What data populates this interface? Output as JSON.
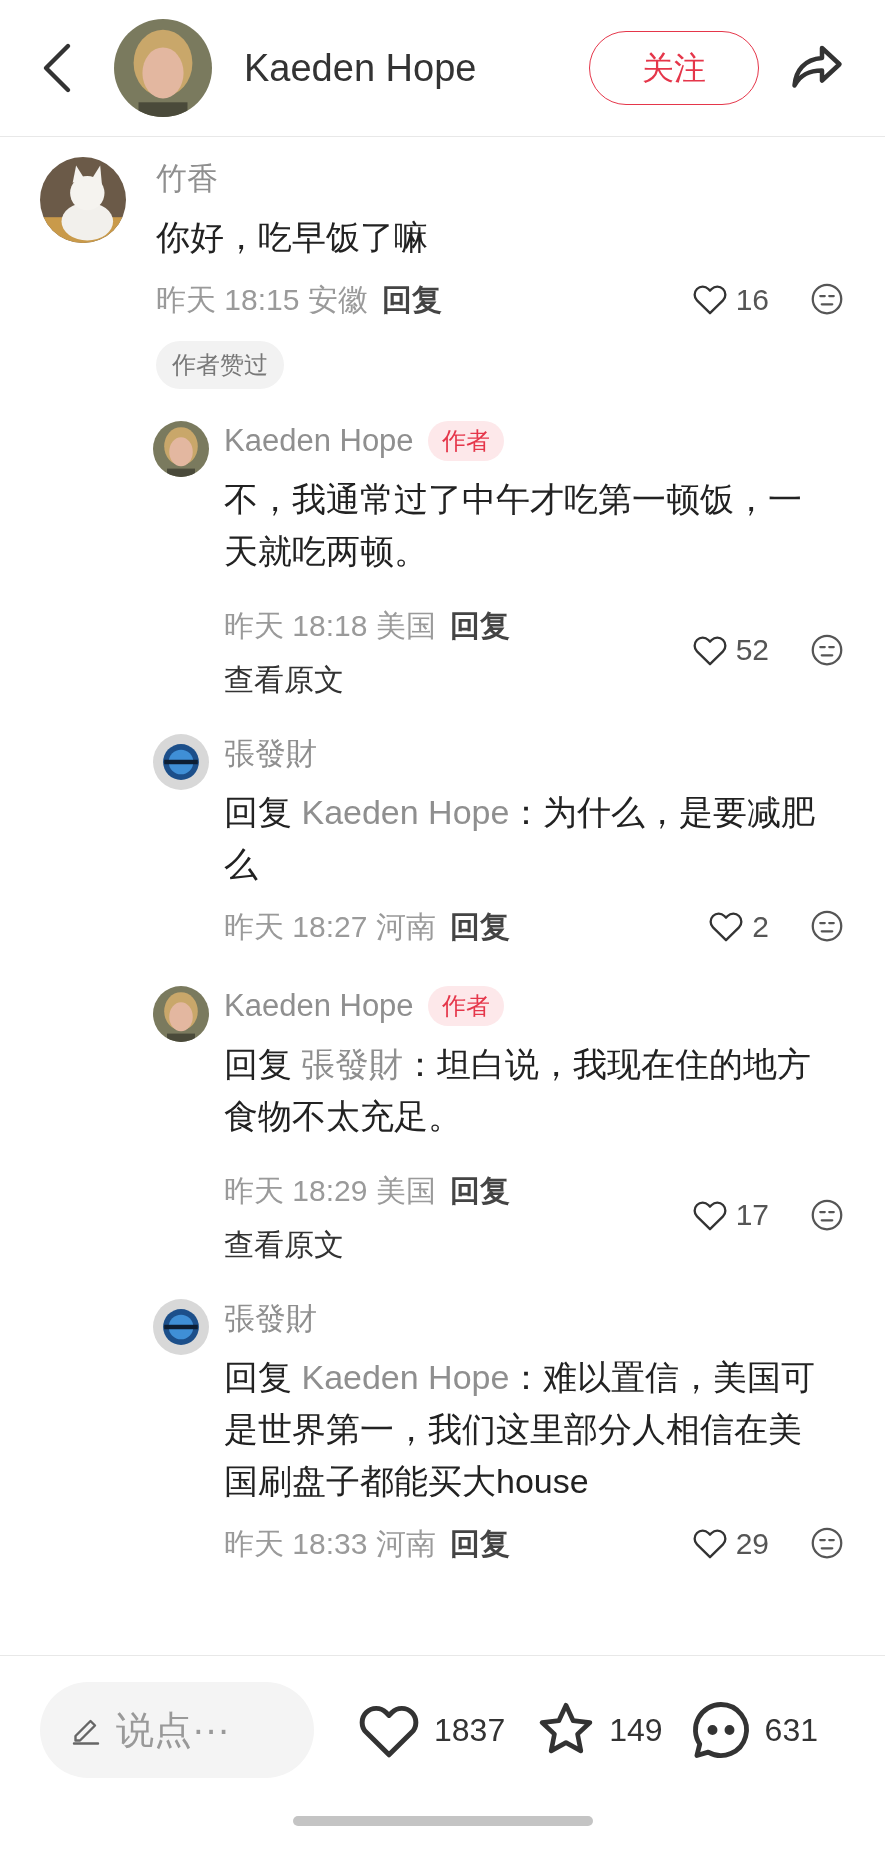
{
  "header": {
    "name": "Kaeden Hope",
    "follow": "关注"
  },
  "comments": [
    {
      "kind": "top",
      "user": "竹香",
      "text": "你好，吃早饭了嘛",
      "time": "昨天 18:15",
      "location": "安徽",
      "reply": "回复",
      "likes": "16",
      "badge": "作者赞过"
    },
    {
      "kind": "reply",
      "user": "Kaeden Hope",
      "author_tag": "作者",
      "text": "不，我通常过了中午才吃第一顿饭，一天就吃两顿。",
      "time": "昨天 18:18",
      "location": "美国",
      "reply": "回复",
      "likes": "52",
      "translate": "查看原文"
    },
    {
      "kind": "reply",
      "user": "張發財",
      "reply_prefix": "回复",
      "reply_to": "Kaeden Hope",
      "text": "：为什么，是要减肥么",
      "time": "昨天 18:27",
      "location": "河南",
      "reply": "回复",
      "likes": "2"
    },
    {
      "kind": "reply",
      "user": "Kaeden Hope",
      "author_tag": "作者",
      "reply_prefix": "回复",
      "reply_to": "張發財",
      "text": "：坦白说，我现在住的地方食物不太充足。",
      "time": "昨天 18:29",
      "location": "美国",
      "reply": "回复",
      "likes": "17",
      "translate": "查看原文"
    },
    {
      "kind": "reply",
      "user": "張發財",
      "reply_prefix": "回复",
      "reply_to": "Kaeden Hope",
      "text": "：难以置信，美国可是世界第一，我们这里部分人相信在美国刷盘子都能买大house",
      "time": "昨天 18:33",
      "location": "河南",
      "reply": "回复",
      "likes": "29"
    }
  ],
  "bottom_bar": {
    "input_placeholder": "说点···",
    "likes": "1837",
    "favorites": "149",
    "comments": "631"
  }
}
